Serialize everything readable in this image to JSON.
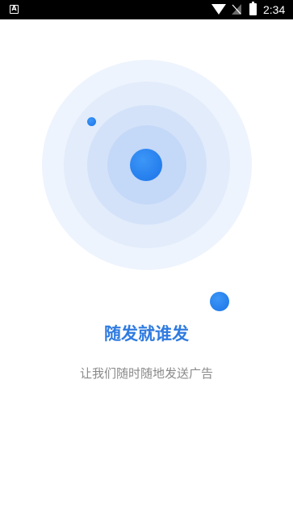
{
  "status_bar": {
    "notification_icon": "a-notification-icon",
    "wifi_icon": "wifi-icon",
    "signal_icon": "no-signal-icon",
    "battery_icon": "battery-charging-icon",
    "time": "2:34"
  },
  "colors": {
    "accent": "#1a73e8",
    "title": "#2f7be0",
    "subtitle": "#8a8a8a",
    "ring_outer": "#eef4fd",
    "ring_inner": "#c4d8f8"
  },
  "main": {
    "title": "随发就谁发",
    "subtitle": "让我们随时随地发送广告"
  }
}
